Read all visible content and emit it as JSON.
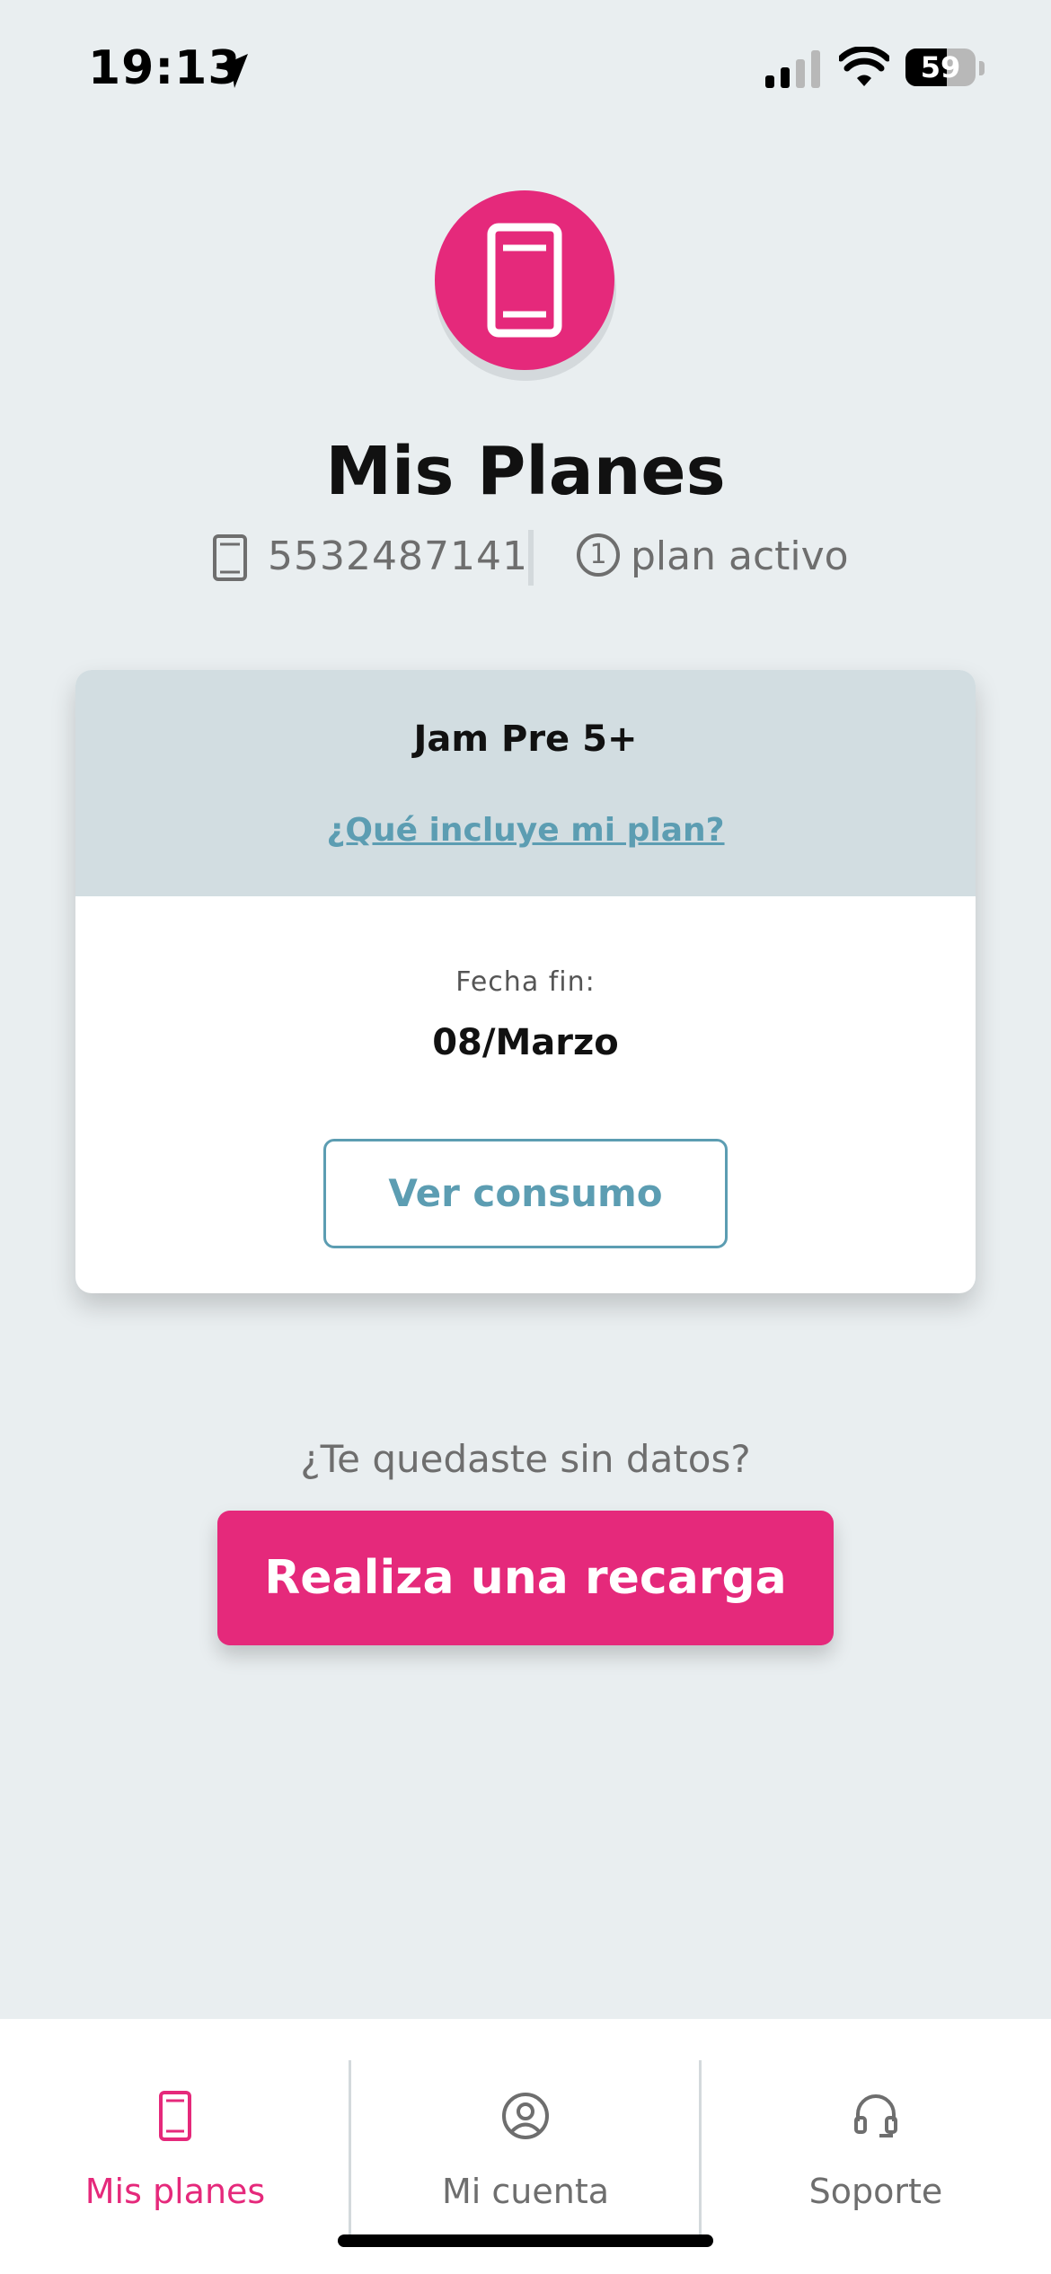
{
  "status_bar": {
    "time": "19:13",
    "battery_level": "59",
    "battery_fraction": 0.59
  },
  "header": {
    "icon": "phone-icon",
    "title": "Mis Planes",
    "phone_number": "5532487141",
    "active_count": "1",
    "active_label": "plan activo"
  },
  "plan": {
    "name": "Jam Pre 5+",
    "link_label": "¿Qué incluye mi plan?",
    "end_label": "Fecha fin:",
    "end_value": "08/Marzo",
    "consume_button": "Ver consumo"
  },
  "recharge": {
    "question": "¿Te quedaste sin datos?",
    "button_label": "Realiza una recarga"
  },
  "nav": {
    "items": [
      {
        "label": "Mis planes",
        "icon": "phone-icon",
        "active": true
      },
      {
        "label": "Mi cuenta",
        "icon": "user-circle-icon",
        "active": false
      },
      {
        "label": "Soporte",
        "icon": "headset-icon",
        "active": false
      }
    ]
  },
  "colors": {
    "accent": "#E5297B",
    "link": "#5C9DB2",
    "background": "#E9EEF0",
    "card_header": "#D2DDE1",
    "muted_text": "#6E6E6E"
  }
}
